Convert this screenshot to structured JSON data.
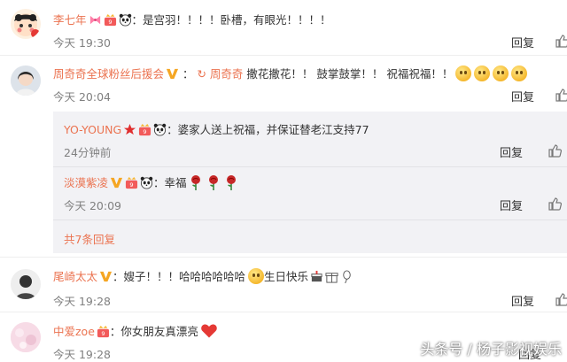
{
  "comments": [
    {
      "author": "李七年",
      "text": "：是宫羽！！！！卧槽，有眼光！！！！",
      "time": "今天 19:30",
      "reply": "回复"
    },
    {
      "author": "周奇奇全球粉丝后援会",
      "mention": "周奇奇",
      "text": " 撒花撒花！！ 鼓掌鼓掌！！ 祝福祝福！！",
      "time": "今天 20:04",
      "reply": "回复",
      "subreplies": [
        {
          "author": "YO-YOUNG",
          "text": "：婆家人送上祝福，并保证替老江支持77",
          "time": "24分钟前",
          "reply": "回复"
        },
        {
          "author": "淡漠紫凌",
          "text": "：幸福",
          "time": "今天 20:09",
          "reply": "回复"
        }
      ],
      "more_replies": "共7条回复"
    },
    {
      "author": "尾崎太太",
      "text": "：嫂子！！！哈哈哈哈哈哈",
      "text2": "生日快乐",
      "time": "今天 19:28",
      "reply": "回复"
    },
    {
      "author": "中爱zoe",
      "text": "：你女朋友真漂亮",
      "time": "今天 19:28",
      "reply": "回复"
    }
  ],
  "watermark": "头条号 / 杨子影视娱乐"
}
